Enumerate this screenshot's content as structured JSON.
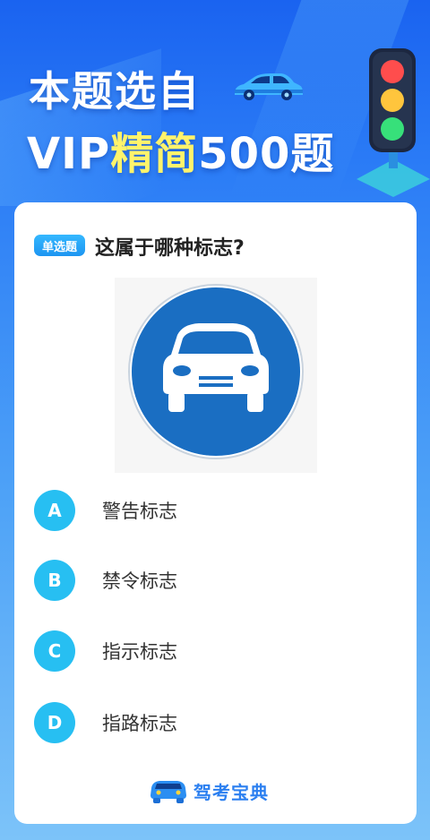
{
  "header": {
    "title_line1": "本题选自",
    "title_line2_prefix": "VIP",
    "title_line2_highlight": "精简",
    "title_line2_suffix": "500题"
  },
  "question": {
    "type_badge": "单选题",
    "text": "这属于哪种标志?"
  },
  "options": [
    {
      "letter": "A",
      "label": "警告标志"
    },
    {
      "letter": "B",
      "label": "禁令标志"
    },
    {
      "letter": "C",
      "label": "指示标志"
    },
    {
      "letter": "D",
      "label": "指路标志"
    }
  ],
  "brand": {
    "name": "驾考宝典"
  },
  "colors": {
    "accent": "#27bff2",
    "sign_blue": "#1a6ec2",
    "highlight_yellow": "#fff36b"
  },
  "icons": {
    "header_car": "car-icon",
    "traffic_light": "traffic-light-icon",
    "brand_logo": "car-logo-icon"
  }
}
